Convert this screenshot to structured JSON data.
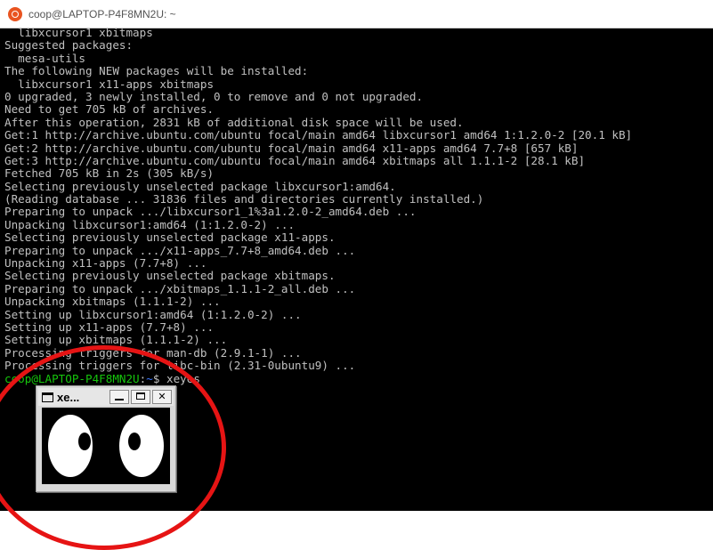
{
  "window": {
    "title": "coop@LAPTOP-P4F8MN2U: ~",
    "icon": "ubuntu-icon"
  },
  "terminal": {
    "lines": [
      "  libxcursor1 xbitmaps",
      "Suggested packages:",
      "  mesa-utils",
      "The following NEW packages will be installed:",
      "  libxcursor1 x11-apps xbitmaps",
      "0 upgraded, 3 newly installed, 0 to remove and 0 not upgraded.",
      "Need to get 705 kB of archives.",
      "After this operation, 2831 kB of additional disk space will be used.",
      "Get:1 http://archive.ubuntu.com/ubuntu focal/main amd64 libxcursor1 amd64 1:1.2.0-2 [20.1 kB]",
      "Get:2 http://archive.ubuntu.com/ubuntu focal/main amd64 x11-apps amd64 7.7+8 [657 kB]",
      "Get:3 http://archive.ubuntu.com/ubuntu focal/main amd64 xbitmaps all 1.1.1-2 [28.1 kB]",
      "Fetched 705 kB in 2s (305 kB/s)",
      "Selecting previously unselected package libxcursor1:amd64.",
      "(Reading database ... 31836 files and directories currently installed.)",
      "Preparing to unpack .../libxcursor1_1%3a1.2.0-2_amd64.deb ...",
      "Unpacking libxcursor1:amd64 (1:1.2.0-2) ...",
      "Selecting previously unselected package x11-apps.",
      "Preparing to unpack .../x11-apps_7.7+8_amd64.deb ...",
      "Unpacking x11-apps (7.7+8) ...",
      "Selecting previously unselected package xbitmaps.",
      "Preparing to unpack .../xbitmaps_1.1.1-2_all.deb ...",
      "Unpacking xbitmaps (1.1.1-2) ...",
      "Setting up libxcursor1:amd64 (1:1.2.0-2) ...",
      "Setting up x11-apps (7.7+8) ...",
      "Setting up xbitmaps (1.1.1-2) ...",
      "Processing triggers for man-db (2.9.1-1) ...",
      "Processing triggers for libc-bin (2.31-0ubuntu9) ..."
    ],
    "prompt": {
      "user_host": "coop@LAPTOP-P4F8MN2U",
      "sep": ":",
      "path": "~",
      "symbol": "$ ",
      "command": "xeyes"
    }
  },
  "xeyes": {
    "title": "xe...",
    "min_label": "",
    "max_label": "",
    "close_label": "✕"
  },
  "colors": {
    "terminal_bg": "#000000",
    "terminal_fg": "#c0c0c0",
    "prompt_user": "#16c60c",
    "prompt_path": "#3b78ff",
    "annotation": "#e61414"
  }
}
